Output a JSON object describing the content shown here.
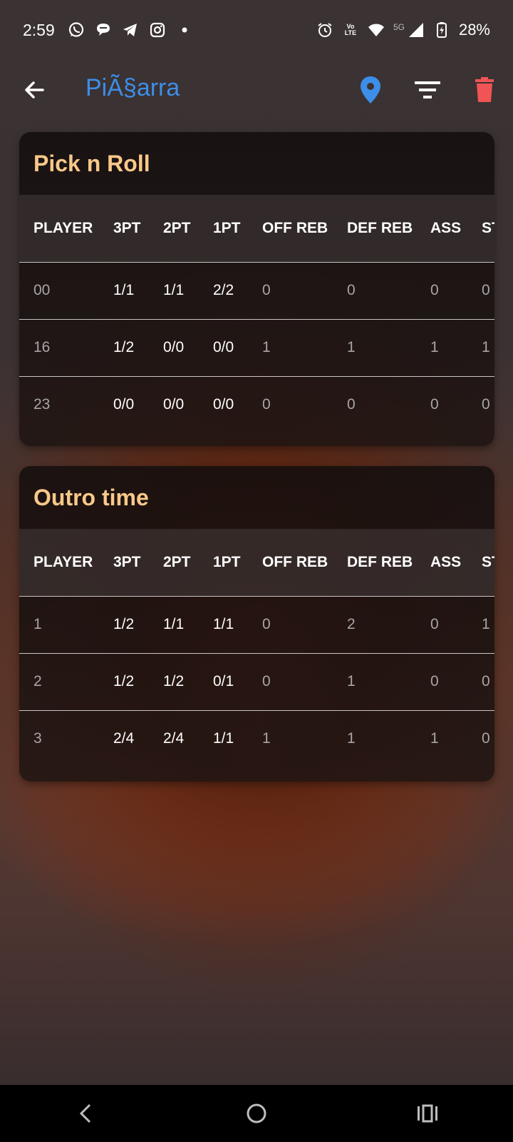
{
  "status_bar": {
    "time": "2:59",
    "network": "5G",
    "volte": "Vo LTE",
    "battery": "28%"
  },
  "app_bar": {
    "title": "PiÃ§arra",
    "accent_color": "#3d8ee8",
    "delete_color": "#f05454"
  },
  "columns": [
    "PLAYER",
    "3PT",
    "2PT",
    "1PT",
    "OFF REB",
    "DEF REB",
    "ASS",
    "ST"
  ],
  "sections": [
    {
      "title": "Pick n Roll",
      "rows": [
        [
          "00",
          "1/1",
          "1/1",
          "2/2",
          "0",
          "0",
          "0",
          "0"
        ],
        [
          "16",
          "1/2",
          "0/0",
          "0/0",
          "1",
          "1",
          "1",
          "1"
        ],
        [
          "23",
          "0/0",
          "0/0",
          "0/0",
          "0",
          "0",
          "0",
          "0"
        ]
      ]
    },
    {
      "title": "Outro time",
      "rows": [
        [
          "1",
          "1/2",
          "1/1",
          "1/1",
          "0",
          "2",
          "0",
          "1"
        ],
        [
          "2",
          "1/2",
          "1/2",
          "0/1",
          "0",
          "1",
          "0",
          "0"
        ],
        [
          "3",
          "2/4",
          "2/4",
          "1/1",
          "1",
          "1",
          "1",
          "0"
        ]
      ]
    }
  ]
}
